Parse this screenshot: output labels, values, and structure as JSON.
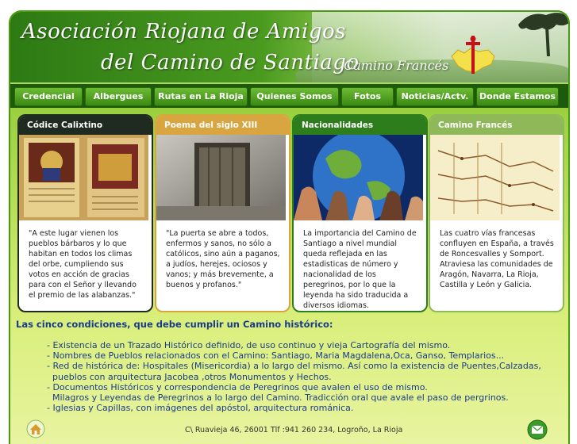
{
  "header": {
    "title_line1": "Asociación Riojana de Amigos",
    "title_line2": "del Camino de Santiago",
    "subtitle": "Camino Francés"
  },
  "nav": {
    "items": [
      {
        "label": "Credencial"
      },
      {
        "label": "Albergues"
      },
      {
        "label": "Rutas en La Rioja"
      },
      {
        "label": "Quienes Somos"
      },
      {
        "label": "Fotos"
      },
      {
        "label": "Noticias/Actv."
      },
      {
        "label": "Donde Estamos"
      }
    ]
  },
  "cards": [
    {
      "title": "Códice Calixtino",
      "image_icon": "manuscript-image",
      "text": "\"A este lugar vienen los pueblos bárbaros y lo que habitan en todos los climas del orbe, cumpliendo sus votos en acción de gracias para con el Señor y llevando el premio de las alabanzas.\""
    },
    {
      "title": "Poema del siglo XIII",
      "image_icon": "old-door-image",
      "text": "\"La puerta se abre a todos, enfermos y sanos, no sólo a católicos, sino aún a paganos, a judíos, herejes, ociosos y vanos; y más brevemente, a buenos y profanos.\""
    },
    {
      "title": "Nacionalidades",
      "image_icon": "globe-hands-image",
      "text": "La importancia del Camino de Santiago a nivel mundial queda reflejada en las estadisticas de número y nacionalidad de los peregrinos, por lo que la leyenda ha sido traducida a diversos idiomas."
    },
    {
      "title": "Camino Francés",
      "image_icon": "route-map-image",
      "text": "Las cuatro vías francesas confluyen en España, a través de Roncesvalles y Somport. Atraviesa las comunidades de Aragón, Navarra, La Rioja, Castilla y León y Galicia."
    }
  ],
  "conditions": {
    "title": "Las cinco condiciones, que debe cumplir un Camino histórico:",
    "items": [
      "- Existencia de un Trazado Histórico definido, de uso continuo y vieja Cartografía del mismo.",
      "- Nombres de Pueblos relacionados con el Camino: Santiago, Maria Magdalena,Oca, Ganso, Templarios...",
      "- Red de histórica de: Hospitales (Misericordia) a lo largo del mismo. Así como la existencia de Puentes,Calzadas,",
      "  pueblos con arquitectura Jacobea ,otros Monumentos y Hechos.",
      "- Documentos Históricos y correspondencia de Peregrinos que avalen el uso de mismo.",
      "  Milagros y Leyendas de Peregrinos a lo largo del Camino. Tradicción oral que avale el paso de pergrinos.",
      "- Iglesias y Capillas, con imágenes del apóstol, arquitectura románica."
    ]
  },
  "footer": {
    "address": "C\\ Ruavieja 46, 26001 Tlf :941 260 234, Logroño, La Rioja"
  },
  "colors": {
    "brand_green": "#2e7d1c",
    "nav_dark": "#1d5a0c",
    "text_blue": "#1a3a8a",
    "gold": "#d9a540"
  }
}
